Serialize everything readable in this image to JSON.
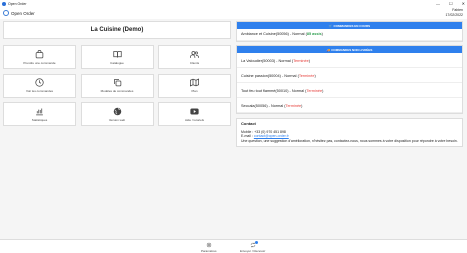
{
  "window": {
    "title": "Open Order",
    "controls": [
      "—",
      "☐",
      "✕"
    ]
  },
  "app": {
    "name": "Open Order",
    "user_name": "Fabien",
    "date": "17/02/2022"
  },
  "restaurant": {
    "name": "La Cuisine (Demo)"
  },
  "tiles": [
    {
      "label": "Prendre une commande",
      "icon": "shopping-bag-icon"
    },
    {
      "label": "Catalogue",
      "icon": "book-icon"
    },
    {
      "label": "Clients",
      "icon": "users-icon"
    },
    {
      "label": "Voir les commandes",
      "icon": "clock-icon"
    },
    {
      "label": "Modèles de commandes",
      "icon": "copy-icon"
    },
    {
      "label": "Plan",
      "icon": "map-icon"
    },
    {
      "label": "Statistiques",
      "icon": "bar-chart-icon"
    },
    {
      "label": "Version web",
      "icon": "globe-icon"
    },
    {
      "label": "Aide / tutoriels",
      "icon": "youtube-icon"
    }
  ],
  "rooms": {
    "header": "COMMANDES EN COURS",
    "items": [
      {
        "name": "Ambiance et Cuisine(50056) - Normal",
        "status": "85 assis"
      }
    ]
  },
  "waiting": {
    "header": "COMMANDES NON LIVRÉES",
    "items": [
      {
        "name": "La Valoudier(50003) - Normal",
        "status": "Terminée"
      },
      {
        "name": "Cuisine passion(50004) - Normal",
        "status": "Terminée"
      },
      {
        "name": "Tout feu tout flammé(50010) - Normal",
        "status": "Terminée"
      },
      {
        "name": "Seccala(50056) - Normal",
        "status": "Terminée"
      }
    ]
  },
  "contact": {
    "title": "Contact",
    "phone": "Mobile : +33 (0) 970 451 898",
    "email_label": "E-mail :",
    "email": "contact@open-order.fr",
    "note": "Une question, une suggestion d'amélioration, n'hésitez pas, contactez-nous, nous sommes à votre disposition pour répondre à votre besoin."
  },
  "bottom": {
    "settings": "Paramètres",
    "sync": "Envoyer / Recevoir"
  }
}
